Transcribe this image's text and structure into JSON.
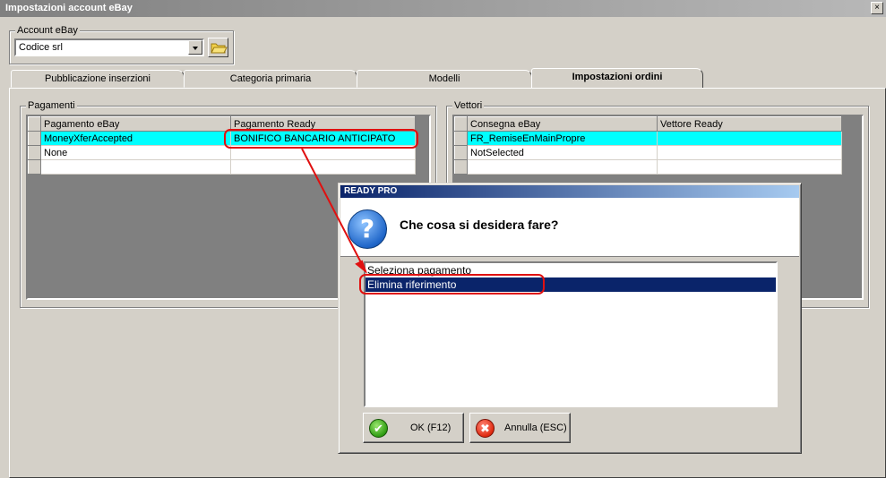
{
  "window": {
    "title": "Impostazioni account eBay",
    "close_glyph": "×"
  },
  "account": {
    "label": "Account eBay",
    "value": "Codice srl"
  },
  "tabs": [
    {
      "label": "Pubblicazione inserzioni"
    },
    {
      "label": "Categoria primaria"
    },
    {
      "label": "Modelli"
    },
    {
      "label": "Impostazioni ordini"
    }
  ],
  "pagamenti": {
    "legend": "Pagamenti",
    "columns": [
      "Pagamento eBay",
      "Pagamento Ready"
    ],
    "rows": [
      [
        "MoneyXferAccepted",
        "BONIFICO BANCARIO ANTICIPATO"
      ],
      [
        "None",
        ""
      ],
      [
        "",
        ""
      ]
    ]
  },
  "vettori": {
    "legend": "Vettori",
    "columns": [
      "Consegna eBay",
      "Vettore Ready"
    ],
    "rows": [
      [
        "FR_RemiseEnMainPropre",
        ""
      ],
      [
        "NotSelected",
        ""
      ],
      [
        "",
        ""
      ]
    ]
  },
  "dialog": {
    "title": "READY PRO",
    "question": "Che cosa si desidera fare?",
    "icon_glyph": "?",
    "options": [
      "Seleziona pagamento",
      "Elimina riferimento"
    ],
    "ok_label": "OK (F12)",
    "cancel_label": "Annulla (ESC)",
    "ok_glyph": "✔",
    "cancel_glyph": "✖"
  },
  "colors": {
    "highlight_row": "#00ffff",
    "annotation_red": "#e01010",
    "list_selection": "#0a246a"
  }
}
